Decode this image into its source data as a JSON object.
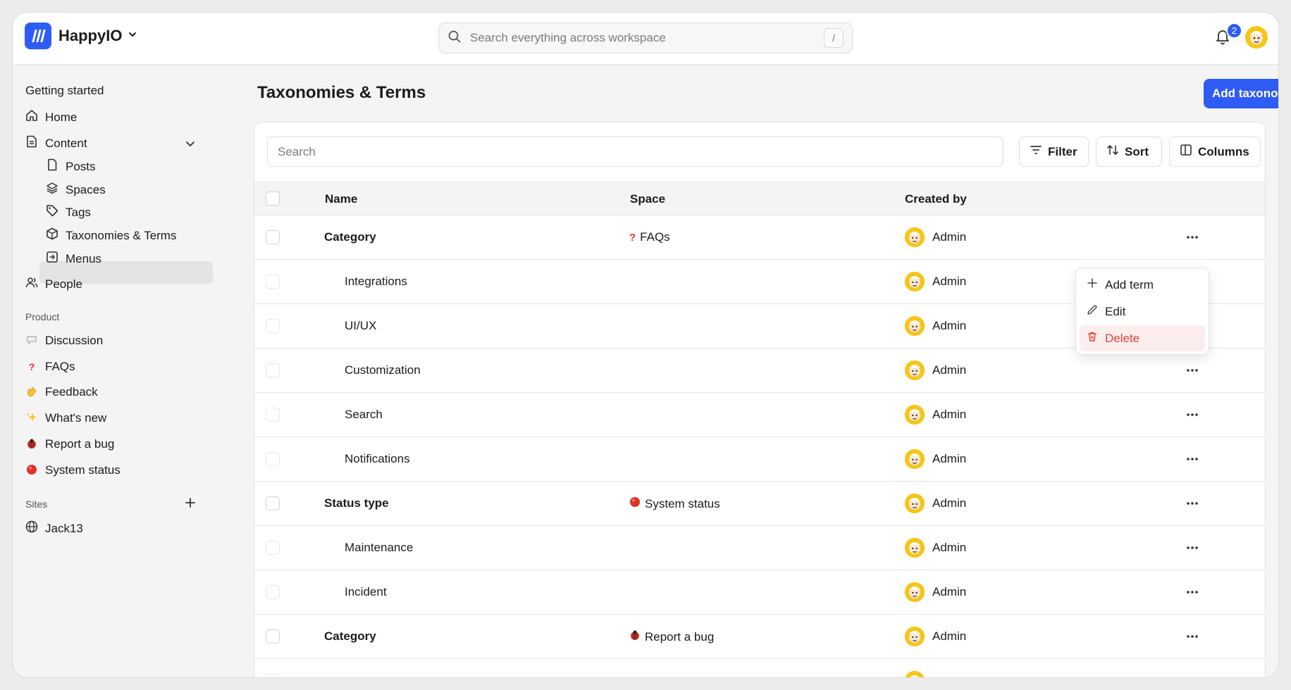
{
  "app": {
    "name": "HappyIO"
  },
  "topbar": {
    "search_placeholder": "Search everything across workspace",
    "search_shortcut": "/",
    "notification_count": "2",
    "accent": "#2f5cf5"
  },
  "sidebar": {
    "getting_started": "Getting started",
    "nav": {
      "home": "Home",
      "content": "Content",
      "content_children": {
        "posts": "Posts",
        "spaces": "Spaces",
        "tags": "Tags",
        "taxonomies": "Taxonomies & Terms",
        "menus": "Menus"
      },
      "people": "People"
    },
    "product_header": "Product",
    "product": {
      "discussion": "Discussion",
      "faqs": "FAQs",
      "feedback": "Feedback",
      "whats_new": "What's new",
      "report_bug": "Report a bug",
      "system_status": "System status"
    },
    "sites_header": "Sites",
    "sites": {
      "jack13": "Jack13"
    }
  },
  "page": {
    "title": "Taxonomies & Terms",
    "add_button": "Add taxonomy",
    "table_search_placeholder": "Search",
    "filter": "Filter",
    "sort": "Sort",
    "columns": "Columns"
  },
  "table": {
    "headers": {
      "name": "Name",
      "space": "Space",
      "created_by": "Created by"
    },
    "rows": [
      {
        "name": "Category",
        "space": "FAQs",
        "created_by": "Admin"
      },
      {
        "name": "Integrations",
        "space": "",
        "created_by": "Admin"
      },
      {
        "name": "UI/UX",
        "space": "",
        "created_by": "Admin"
      },
      {
        "name": "Customization",
        "space": "",
        "created_by": "Admin"
      },
      {
        "name": "Search",
        "space": "",
        "created_by": "Admin"
      },
      {
        "name": "Notifications",
        "space": "",
        "created_by": "Admin"
      },
      {
        "name": "Status type",
        "space": "System status",
        "created_by": "Admin"
      },
      {
        "name": "Maintenance",
        "space": "",
        "created_by": "Admin"
      },
      {
        "name": "Incident",
        "space": "",
        "created_by": "Admin"
      },
      {
        "name": "Category",
        "space": "Report a bug",
        "created_by": "Admin"
      }
    ]
  },
  "context_menu": {
    "add_term": "Add term",
    "edit": "Edit",
    "delete": "Delete"
  }
}
